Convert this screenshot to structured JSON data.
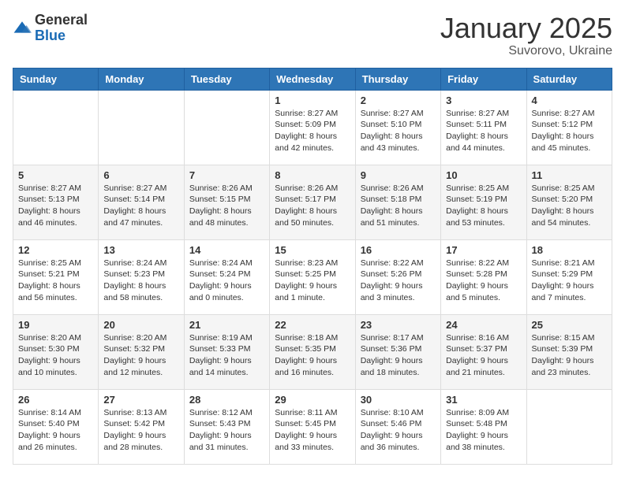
{
  "header": {
    "logo": {
      "general": "General",
      "blue": "Blue"
    },
    "title": "January 2025",
    "subtitle": "Suvorovo, Ukraine"
  },
  "weekdays": [
    "Sunday",
    "Monday",
    "Tuesday",
    "Wednesday",
    "Thursday",
    "Friday",
    "Saturday"
  ],
  "weeks": [
    [
      {
        "day": "",
        "info": ""
      },
      {
        "day": "",
        "info": ""
      },
      {
        "day": "",
        "info": ""
      },
      {
        "day": "1",
        "info": "Sunrise: 8:27 AM\nSunset: 5:09 PM\nDaylight: 8 hours and 42 minutes."
      },
      {
        "day": "2",
        "info": "Sunrise: 8:27 AM\nSunset: 5:10 PM\nDaylight: 8 hours and 43 minutes."
      },
      {
        "day": "3",
        "info": "Sunrise: 8:27 AM\nSunset: 5:11 PM\nDaylight: 8 hours and 44 minutes."
      },
      {
        "day": "4",
        "info": "Sunrise: 8:27 AM\nSunset: 5:12 PM\nDaylight: 8 hours and 45 minutes."
      }
    ],
    [
      {
        "day": "5",
        "info": "Sunrise: 8:27 AM\nSunset: 5:13 PM\nDaylight: 8 hours and 46 minutes."
      },
      {
        "day": "6",
        "info": "Sunrise: 8:27 AM\nSunset: 5:14 PM\nDaylight: 8 hours and 47 minutes."
      },
      {
        "day": "7",
        "info": "Sunrise: 8:26 AM\nSunset: 5:15 PM\nDaylight: 8 hours and 48 minutes."
      },
      {
        "day": "8",
        "info": "Sunrise: 8:26 AM\nSunset: 5:17 PM\nDaylight: 8 hours and 50 minutes."
      },
      {
        "day": "9",
        "info": "Sunrise: 8:26 AM\nSunset: 5:18 PM\nDaylight: 8 hours and 51 minutes."
      },
      {
        "day": "10",
        "info": "Sunrise: 8:25 AM\nSunset: 5:19 PM\nDaylight: 8 hours and 53 minutes."
      },
      {
        "day": "11",
        "info": "Sunrise: 8:25 AM\nSunset: 5:20 PM\nDaylight: 8 hours and 54 minutes."
      }
    ],
    [
      {
        "day": "12",
        "info": "Sunrise: 8:25 AM\nSunset: 5:21 PM\nDaylight: 8 hours and 56 minutes."
      },
      {
        "day": "13",
        "info": "Sunrise: 8:24 AM\nSunset: 5:23 PM\nDaylight: 8 hours and 58 minutes."
      },
      {
        "day": "14",
        "info": "Sunrise: 8:24 AM\nSunset: 5:24 PM\nDaylight: 9 hours and 0 minutes."
      },
      {
        "day": "15",
        "info": "Sunrise: 8:23 AM\nSunset: 5:25 PM\nDaylight: 9 hours and 1 minute."
      },
      {
        "day": "16",
        "info": "Sunrise: 8:22 AM\nSunset: 5:26 PM\nDaylight: 9 hours and 3 minutes."
      },
      {
        "day": "17",
        "info": "Sunrise: 8:22 AM\nSunset: 5:28 PM\nDaylight: 9 hours and 5 minutes."
      },
      {
        "day": "18",
        "info": "Sunrise: 8:21 AM\nSunset: 5:29 PM\nDaylight: 9 hours and 7 minutes."
      }
    ],
    [
      {
        "day": "19",
        "info": "Sunrise: 8:20 AM\nSunset: 5:30 PM\nDaylight: 9 hours and 10 minutes."
      },
      {
        "day": "20",
        "info": "Sunrise: 8:20 AM\nSunset: 5:32 PM\nDaylight: 9 hours and 12 minutes."
      },
      {
        "day": "21",
        "info": "Sunrise: 8:19 AM\nSunset: 5:33 PM\nDaylight: 9 hours and 14 minutes."
      },
      {
        "day": "22",
        "info": "Sunrise: 8:18 AM\nSunset: 5:35 PM\nDaylight: 9 hours and 16 minutes."
      },
      {
        "day": "23",
        "info": "Sunrise: 8:17 AM\nSunset: 5:36 PM\nDaylight: 9 hours and 18 minutes."
      },
      {
        "day": "24",
        "info": "Sunrise: 8:16 AM\nSunset: 5:37 PM\nDaylight: 9 hours and 21 minutes."
      },
      {
        "day": "25",
        "info": "Sunrise: 8:15 AM\nSunset: 5:39 PM\nDaylight: 9 hours and 23 minutes."
      }
    ],
    [
      {
        "day": "26",
        "info": "Sunrise: 8:14 AM\nSunset: 5:40 PM\nDaylight: 9 hours and 26 minutes."
      },
      {
        "day": "27",
        "info": "Sunrise: 8:13 AM\nSunset: 5:42 PM\nDaylight: 9 hours and 28 minutes."
      },
      {
        "day": "28",
        "info": "Sunrise: 8:12 AM\nSunset: 5:43 PM\nDaylight: 9 hours and 31 minutes."
      },
      {
        "day": "29",
        "info": "Sunrise: 8:11 AM\nSunset: 5:45 PM\nDaylight: 9 hours and 33 minutes."
      },
      {
        "day": "30",
        "info": "Sunrise: 8:10 AM\nSunset: 5:46 PM\nDaylight: 9 hours and 36 minutes."
      },
      {
        "day": "31",
        "info": "Sunrise: 8:09 AM\nSunset: 5:48 PM\nDaylight: 9 hours and 38 minutes."
      },
      {
        "day": "",
        "info": ""
      }
    ]
  ]
}
